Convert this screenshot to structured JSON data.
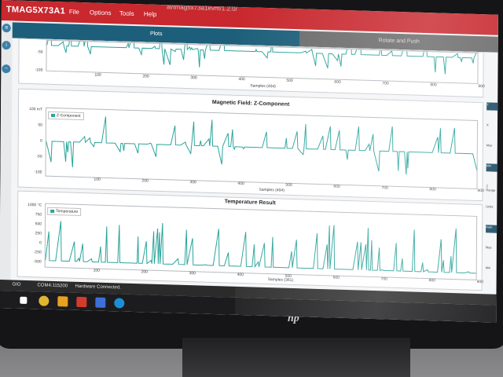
{
  "app": {
    "title": "TMAG5X73A1",
    "path_fragment": "al/tmag5x73a1evm/1.2.0/",
    "menu": [
      "File",
      "Options",
      "Tools",
      "Help"
    ]
  },
  "tabs": {
    "plots": "Plots",
    "rotate": "Rotate and Push"
  },
  "panels": {
    "top": {
      "yticks": [
        "-50",
        "-100"
      ],
      "xticks": [
        "100",
        "200",
        "300",
        "400",
        "500",
        "600",
        "700",
        "800",
        "900"
      ],
      "xaxis_title": "Samples (404)"
    },
    "z": {
      "title": "Magnetic Field: Z-Component",
      "yticks": [
        "100 mT",
        "50",
        "0",
        "-50",
        "-100"
      ],
      "xticks": [
        "100",
        "200",
        "300",
        "400",
        "500",
        "600",
        "700",
        "800",
        "900"
      ],
      "xaxis_title": "Samples (404)",
      "legend": "Z-Component"
    },
    "temp": {
      "title": "Temperature Result",
      "yticks": [
        "1000 °C",
        "750",
        "500",
        "250",
        "0",
        "-250",
        "-500"
      ],
      "xticks": [
        "100",
        "200",
        "300",
        "400",
        "500",
        "600",
        "700",
        "800",
        "900"
      ],
      "xaxis_title": "Samples (361)",
      "legend": "Temperature"
    }
  },
  "right_controls": [
    "Y",
    "X",
    "Max",
    "Min",
    "Z Range",
    "Units",
    "Auto",
    "Max",
    "Min"
  ],
  "status": {
    "gio": "GIO",
    "port": "COM4:115200",
    "connection": "Hardware Connected."
  },
  "brand": "hp",
  "colors": {
    "titlebar": "#c8282e",
    "tab_active": "#1d5f7a",
    "trace": "#2aa39a"
  }
}
